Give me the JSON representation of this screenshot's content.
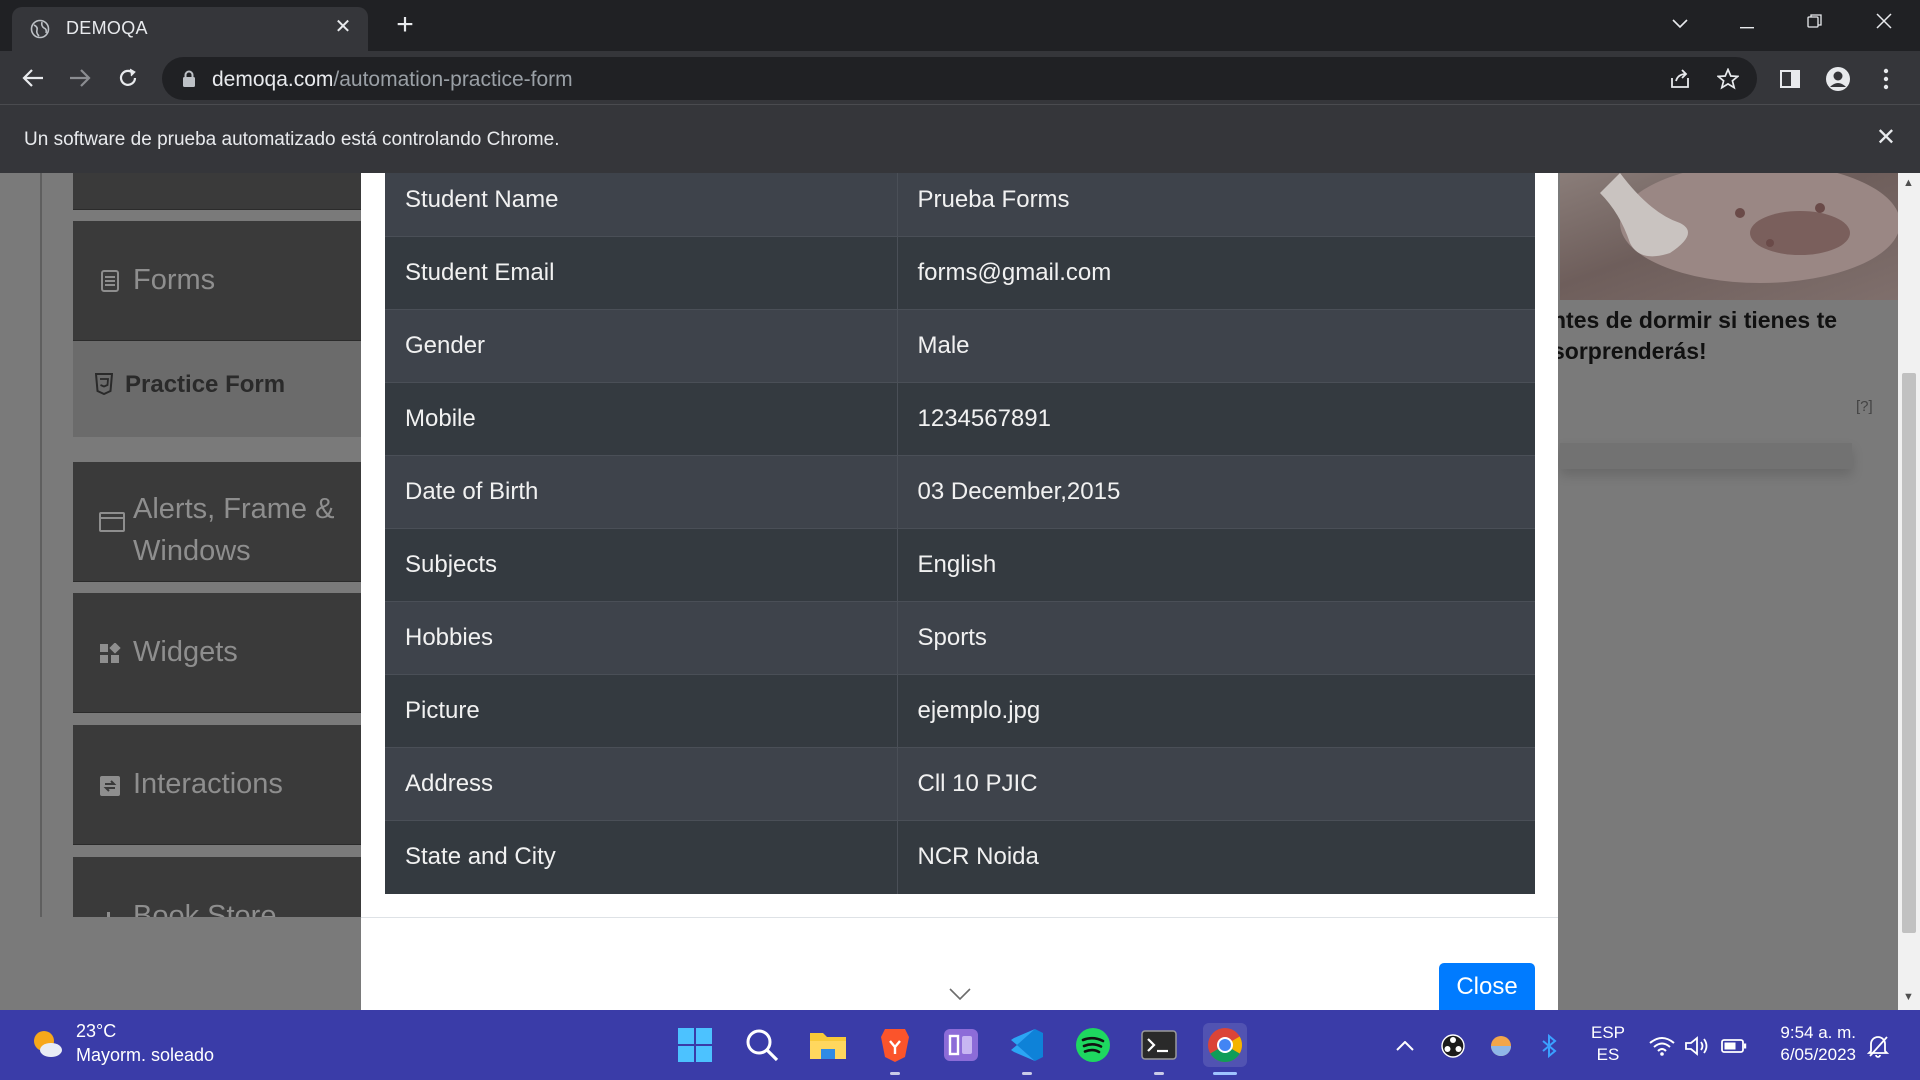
{
  "browser": {
    "tab_title": "DEMOQA",
    "url_host": "demoqa.com",
    "url_path": "/automation-practice-form",
    "infobar_text": "Un software de prueba automatizado está controlando Chrome."
  },
  "sidebar": {
    "items": [
      {
        "label": "Forms",
        "icon": "form-icon"
      },
      {
        "label": "Practice Form",
        "icon": "html5-icon",
        "active": true
      },
      {
        "label": "Alerts, Frame & Windows",
        "icon": "window-icon"
      },
      {
        "label": "Widgets",
        "icon": "widgets-icon"
      },
      {
        "label": "Interactions",
        "icon": "interactions-icon"
      },
      {
        "label": "Book Store",
        "icon": "bar-chart-icon"
      }
    ]
  },
  "ad": {
    "text": "ntes de dormir si tienes te sorprenderás!",
    "mark": "[?]"
  },
  "results": {
    "rows": [
      {
        "label": "Student Name",
        "value": "Prueba Forms"
      },
      {
        "label": "Student Email",
        "value": "forms@gmail.com"
      },
      {
        "label": "Gender",
        "value": "Male"
      },
      {
        "label": "Mobile",
        "value": "1234567891"
      },
      {
        "label": "Date of Birth",
        "value": "03 December,2015"
      },
      {
        "label": "Subjects",
        "value": "English"
      },
      {
        "label": "Hobbies",
        "value": "Sports"
      },
      {
        "label": "Picture",
        "value": "ejemplo.jpg"
      },
      {
        "label": "Address",
        "value": "Cll 10 PJIC"
      },
      {
        "label": "State and City",
        "value": "NCR Noida"
      }
    ],
    "close_label": "Close"
  },
  "taskbar": {
    "weather_temp": "23°C",
    "weather_desc": "Mayorm. soleado",
    "lang_top": "ESP",
    "lang_bottom": "ES",
    "time": "9:54 a. m.",
    "date": "6/05/2023",
    "apps": [
      "windows-start-icon",
      "search-icon",
      "file-explorer-icon",
      "brave-icon",
      "onenote-icon",
      "vscode-icon",
      "spotify-icon",
      "terminal-icon",
      "chrome-icon"
    ]
  },
  "colors": {
    "table_row_odd": "#3e434b",
    "table_row_even": "#343a40",
    "close_button": "#007bff",
    "taskbar": "#3a3ca8"
  }
}
